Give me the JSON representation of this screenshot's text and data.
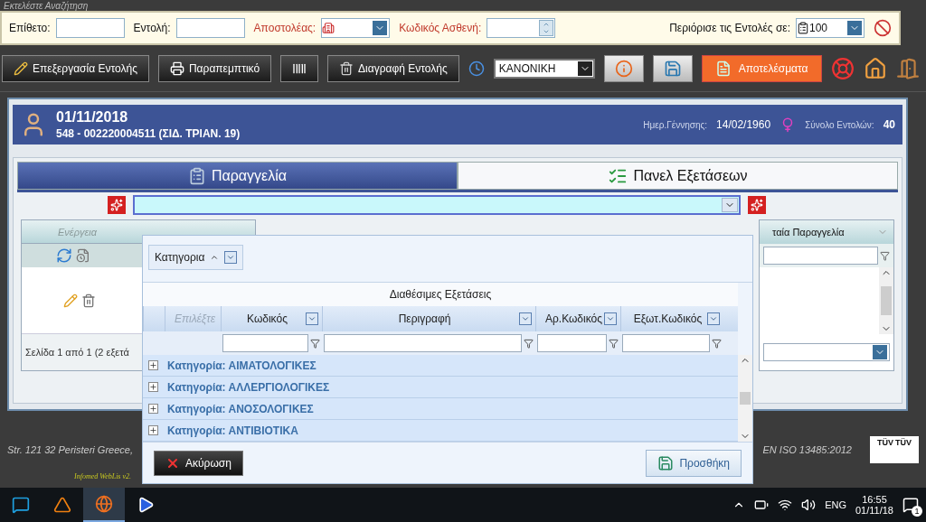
{
  "hint": "Εκτελέστε Αναζήτηση",
  "search_bar": {
    "fields": [
      {
        "label": "Επίθετο:",
        "kind": "text",
        "required": false
      },
      {
        "label": "Εντολή:",
        "kind": "text",
        "required": false
      },
      {
        "label": "Αποστολέας:",
        "kind": "select",
        "required": true
      },
      {
        "label": "Κωδικός Ασθενή:",
        "kind": "spinner",
        "required": true
      }
    ],
    "limit": {
      "label": "Περιόρισε τις Εντολές σε:",
      "value": "100"
    }
  },
  "toolbar": {
    "buttons": [
      {
        "label": "Επεξεργασία Εντολής",
        "kind": "edit"
      },
      {
        "label": "Παραπεμπτικό",
        "kind": "print"
      },
      {
        "kind": "barcode"
      },
      {
        "label": "Διαγραφή Εντολής",
        "kind": "delete"
      }
    ],
    "priority": "ΚΑΝΟΝΙΚΗ",
    "results": "Αποτελέσματα"
  },
  "patient": {
    "date": "01/11/2018",
    "id_line": "548 - 002220004511 (ΣΙΔ. ΤΡΙΑΝ. 19)",
    "birth_label": "Ημερ.Γέννησης:",
    "birth": "14/02/1960",
    "orders_label": "Σύνολο Εντολών:",
    "orders": "40"
  },
  "tabs": [
    {
      "label": "Παραγγελία",
      "selected": true
    },
    {
      "label": "Πανελ Εξετάσεων",
      "selected": false
    }
  ],
  "orders_grid": {
    "action_column": "Ενέργεια",
    "pager": "Σελίδα 1 από 1 (2 εξετά",
    "right_column": "ταία Παραγγελία"
  },
  "popup": {
    "group_by": "Κατηγορια",
    "title": "Διαθέσιμες Εξετάσεις",
    "columns": [
      {
        "label": "Επιλέξτε",
        "filter": false
      },
      {
        "label": "Κωδικός",
        "filter": true
      },
      {
        "label": "Περιγραφή",
        "filter": true
      },
      {
        "label": "Αρ.Κωδικός",
        "filter": true
      },
      {
        "label": "Εξωτ.Κωδικός",
        "filter": true
      }
    ],
    "groups": [
      "Κατηγορία: ΑΙΜΑΤΟΛΟΓΙΚΕΣ",
      "Κατηγορία: ΑΛΛΕΡΓΙΟΛΟΓΙΚΕΣ",
      "Κατηγορία: ΑΝΟΣΟΛΟΓΙΚΕΣ",
      "Κατηγορία: ΑΝΤΙΒΙΟΤΙΚΑ"
    ],
    "cancel": "Ακύρωση",
    "add": "Προσθήκη"
  },
  "footer": {
    "address": "Str. 121 32 Peristeri Greece,",
    "version": "Infomed WebLis v2.",
    "iso": "EN ISO 13485:2012",
    "cert": [
      "TÜV",
      "TÜV"
    ]
  },
  "taskbar": {
    "lang": "ENG",
    "time": "16:55",
    "date": "01/11/18",
    "notifications": "1"
  }
}
